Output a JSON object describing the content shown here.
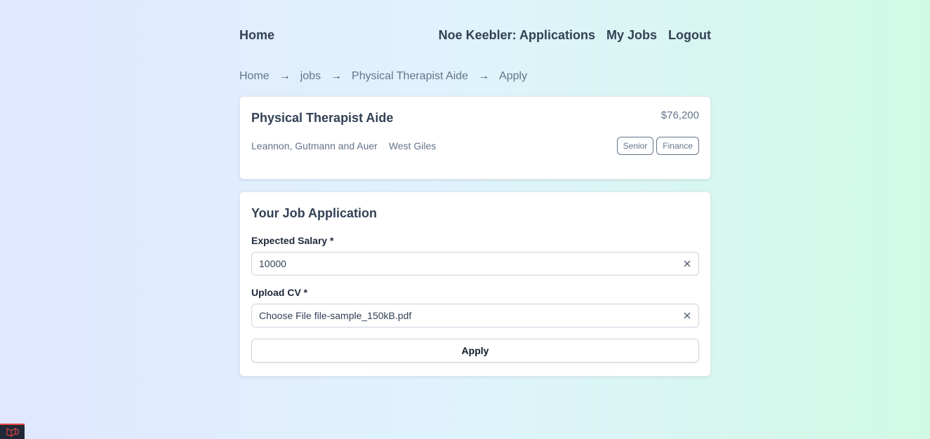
{
  "nav": {
    "home_label": "Home",
    "applications_label": "Noe Keebler: Applications",
    "my_jobs_label": "My Jobs",
    "logout_label": "Logout"
  },
  "breadcrumb": {
    "items": [
      "Home",
      "jobs",
      "Physical Therapist Aide",
      "Apply"
    ],
    "separator": "→"
  },
  "job": {
    "title": "Physical Therapist Aide",
    "salary": "$76,200",
    "company": "Leannon, Gutmann and Auer",
    "location": "West Giles",
    "tags": [
      "Senior",
      "Finance"
    ]
  },
  "application": {
    "title": "Your Job Application",
    "salary_label": "Expected Salary *",
    "salary_value": "10000",
    "cv_label": "Upload CV *",
    "cv_button_label": "Choose File",
    "cv_file_name": "file-sample_150kB.pdf",
    "apply_label": "Apply"
  },
  "icons": {
    "clear": "close-icon",
    "debug": "laravel-logo-icon"
  },
  "colors": {
    "text": "#334155",
    "muted": "#64748b",
    "debug_accent": "#ef4444"
  }
}
